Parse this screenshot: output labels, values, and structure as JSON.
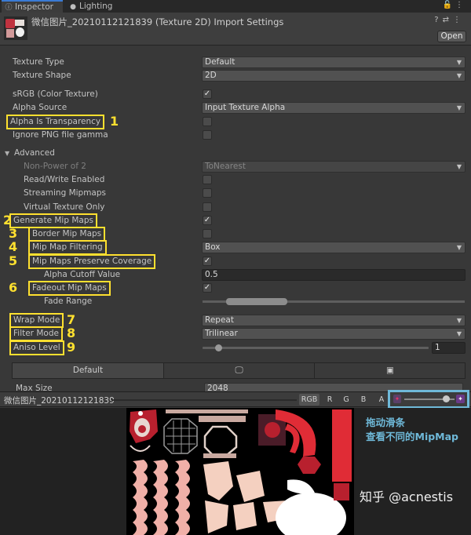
{
  "tabs": [
    {
      "label": "Inspector",
      "icon": "info-icon"
    },
    {
      "label": "Lighting",
      "icon": "lightbulb-icon"
    }
  ],
  "header": {
    "title": "微信图片_20210112121839 (Texture 2D) Import Settings",
    "open_label": "Open"
  },
  "settings": {
    "texture_type": {
      "label": "Texture Type",
      "value": "Default"
    },
    "texture_shape": {
      "label": "Texture Shape",
      "value": "2D"
    },
    "srgb": {
      "label": "sRGB (Color Texture)",
      "checked": true
    },
    "alpha_source": {
      "label": "Alpha Source",
      "value": "Input Texture Alpha"
    },
    "alpha_is_transparency": {
      "label": "Alpha Is Transparency",
      "checked": false
    },
    "ignore_png_gamma": {
      "label": "Ignore PNG file gamma",
      "checked": false
    },
    "advanced": {
      "label": "Advanced"
    },
    "non_power_of_2": {
      "label": "Non-Power of 2",
      "value": "ToNearest"
    },
    "read_write": {
      "label": "Read/Write Enabled",
      "checked": false
    },
    "streaming_mipmaps": {
      "label": "Streaming Mipmaps",
      "checked": false
    },
    "virtual_texture_only": {
      "label": "Virtual Texture Only",
      "checked": false
    },
    "generate_mip_maps": {
      "label": "Generate Mip Maps",
      "checked": true
    },
    "border_mip_maps": {
      "label": "Border Mip Maps",
      "checked": false
    },
    "mip_map_filtering": {
      "label": "Mip Map Filtering",
      "value": "Box"
    },
    "mip_maps_preserve_coverage": {
      "label": "Mip Maps Preserve Coverage",
      "checked": true
    },
    "alpha_cutoff": {
      "label": "Alpha Cutoff Value",
      "value": "0.5"
    },
    "fadeout_mip_maps": {
      "label": "Fadeout Mip Maps",
      "checked": true
    },
    "fade_range": {
      "label": "Fade Range"
    },
    "wrap_mode": {
      "label": "Wrap Mode",
      "value": "Repeat"
    },
    "filter_mode": {
      "label": "Filter Mode",
      "value": "Trilinear"
    },
    "aniso_level": {
      "label": "Aniso Level",
      "value": "1"
    }
  },
  "annotations": [
    "1",
    "2",
    "3",
    "4",
    "5",
    "6",
    "7",
    "8",
    "9"
  ],
  "platform": {
    "tabs": [
      "Default"
    ],
    "max_size": {
      "label": "Max Size",
      "value": "2048"
    }
  },
  "preview": {
    "title": "微信图片_20210112121839",
    "channels": [
      "RGB",
      "R",
      "G",
      "B",
      "A"
    ],
    "mip_note_line1": "拖动滑条",
    "mip_note_line2": "查看不同的MipMap"
  },
  "watermark": "知乎 @acnestis",
  "colors": {
    "highlight": "#ffe02f",
    "annotation_blue": "#6fb9d9",
    "accent_tab": "#3a7bd5"
  }
}
